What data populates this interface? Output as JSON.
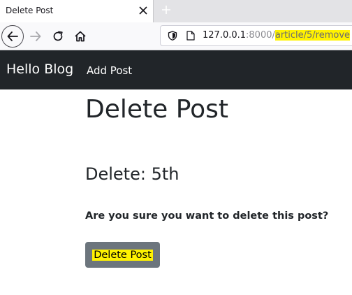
{
  "browser": {
    "tab_title": "Delete Post",
    "url": {
      "host": "127.0.0.1",
      "port": ":8000/",
      "path": "article/5/remove"
    }
  },
  "site_nav": {
    "brand": "Hello Blog",
    "links": [
      "Add Post"
    ]
  },
  "page": {
    "title": "Delete Post",
    "delete_heading": "Delete: 5th",
    "confirm_text": "Are you sure you want to delete this post?",
    "delete_button_label": "Delete Post"
  },
  "colors": {
    "navbar_bg": "#212529",
    "button_bg": "#6c757d",
    "highlight": "#fff200"
  }
}
